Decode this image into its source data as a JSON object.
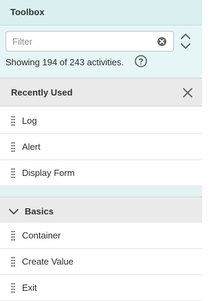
{
  "toolbox": {
    "title": "Toolbox"
  },
  "filter": {
    "placeholder": "Filter",
    "value": "",
    "count_text": "Showing 194 of 243 activities."
  },
  "icons": {
    "clear": "clear-circle-icon",
    "expand": "expand-collapse-icon",
    "help": "question-circle-icon",
    "close": "close-icon",
    "chevron": "chevron-down-icon",
    "drag": "drag-handle-icon"
  },
  "recently_used": {
    "label": "Recently Used",
    "items": [
      {
        "label": "Log"
      },
      {
        "label": "Alert"
      },
      {
        "label": "Display Form"
      }
    ]
  },
  "basics": {
    "label": "Basics",
    "items": [
      {
        "label": "Container"
      },
      {
        "label": "Create Value"
      },
      {
        "label": "Exit"
      }
    ]
  },
  "colors": {
    "header_bg": "#d9eff0",
    "filter_bg": "#e6f5f5",
    "section_bg": "#eaeaea"
  }
}
